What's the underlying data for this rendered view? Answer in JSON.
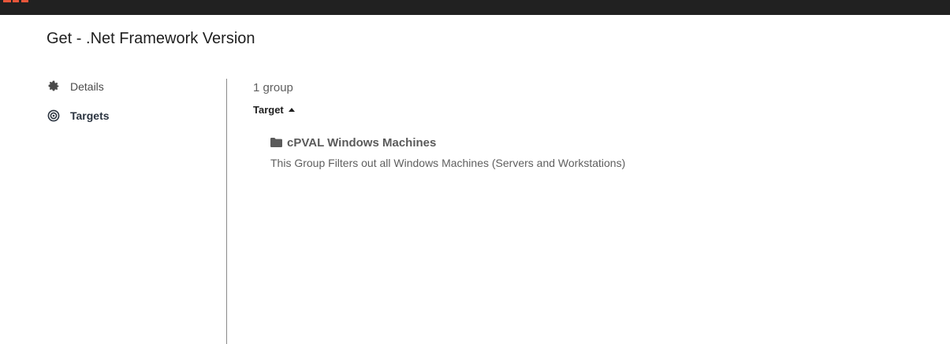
{
  "page": {
    "title": "Get - .Net Framework Version"
  },
  "sidebar": {
    "items": [
      {
        "label": "Details",
        "icon": "gear-icon",
        "active": false
      },
      {
        "label": "Targets",
        "icon": "target-icon",
        "active": true
      }
    ]
  },
  "targets": {
    "count_label": "1 group",
    "sort_column_label": "Target",
    "sort_direction": "ascending",
    "groups": [
      {
        "name": "cPVAL Windows Machines",
        "icon": "folder-icon",
        "description": "This Group Filters out all Windows Machines (Servers and Workstations)"
      }
    ]
  },
  "colors": {
    "topbar": "#212121",
    "brand_accent": "#e8553a",
    "divider": "#8a8a8a"
  }
}
